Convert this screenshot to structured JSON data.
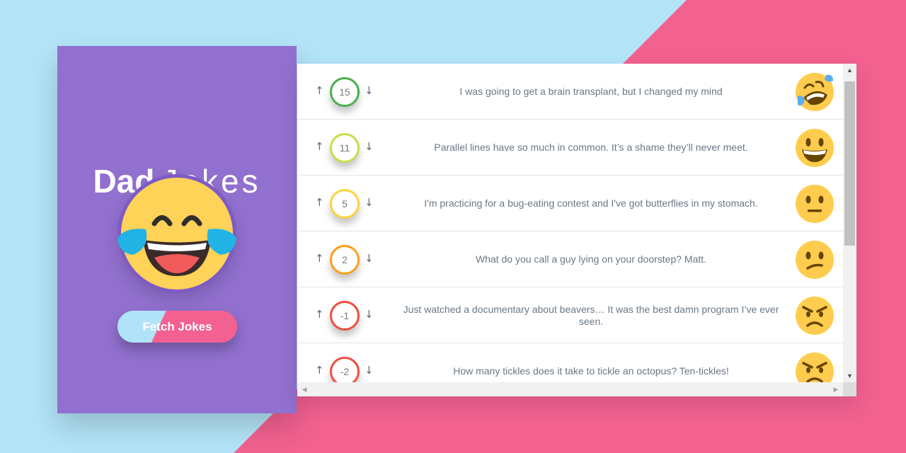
{
  "app": {
    "title_bold": "Dad",
    "title_light": "Jokes",
    "fetch_label": "Fetch Jokes"
  },
  "jokes": [
    {
      "score": "15",
      "text": "I was going to get a brain transplant, but I changed my mind",
      "color": "#4caf50",
      "face": "rofl"
    },
    {
      "score": "11",
      "text": "Parallel lines have so much in common. It’s a shame they’ll never meet.",
      "color": "#c6e04a",
      "face": "grin"
    },
    {
      "score": "5",
      "text": "I'm practicing for a bug-eating contest and I've got butterflies in my stomach.",
      "color": "#ffd23a",
      "face": "neutral"
    },
    {
      "score": "2",
      "text": "What do you call a guy lying on your doorstep? Matt.",
      "color": "#ff9e1b",
      "face": "confused"
    },
    {
      "score": "-1",
      "text": "Just watched a documentary about beavers… It was the best damn program I’ve ever seen.",
      "color": "#f04e3e",
      "face": "angry"
    },
    {
      "score": "-2",
      "text": "How many tickles does it take to tickle an octopus? Ten-tickles!",
      "color": "#f04e3e",
      "face": "angry"
    }
  ],
  "colors": {
    "background_blue": "#b3e4f8",
    "background_pink": "#f26190",
    "sidebar": "#9270cf"
  }
}
